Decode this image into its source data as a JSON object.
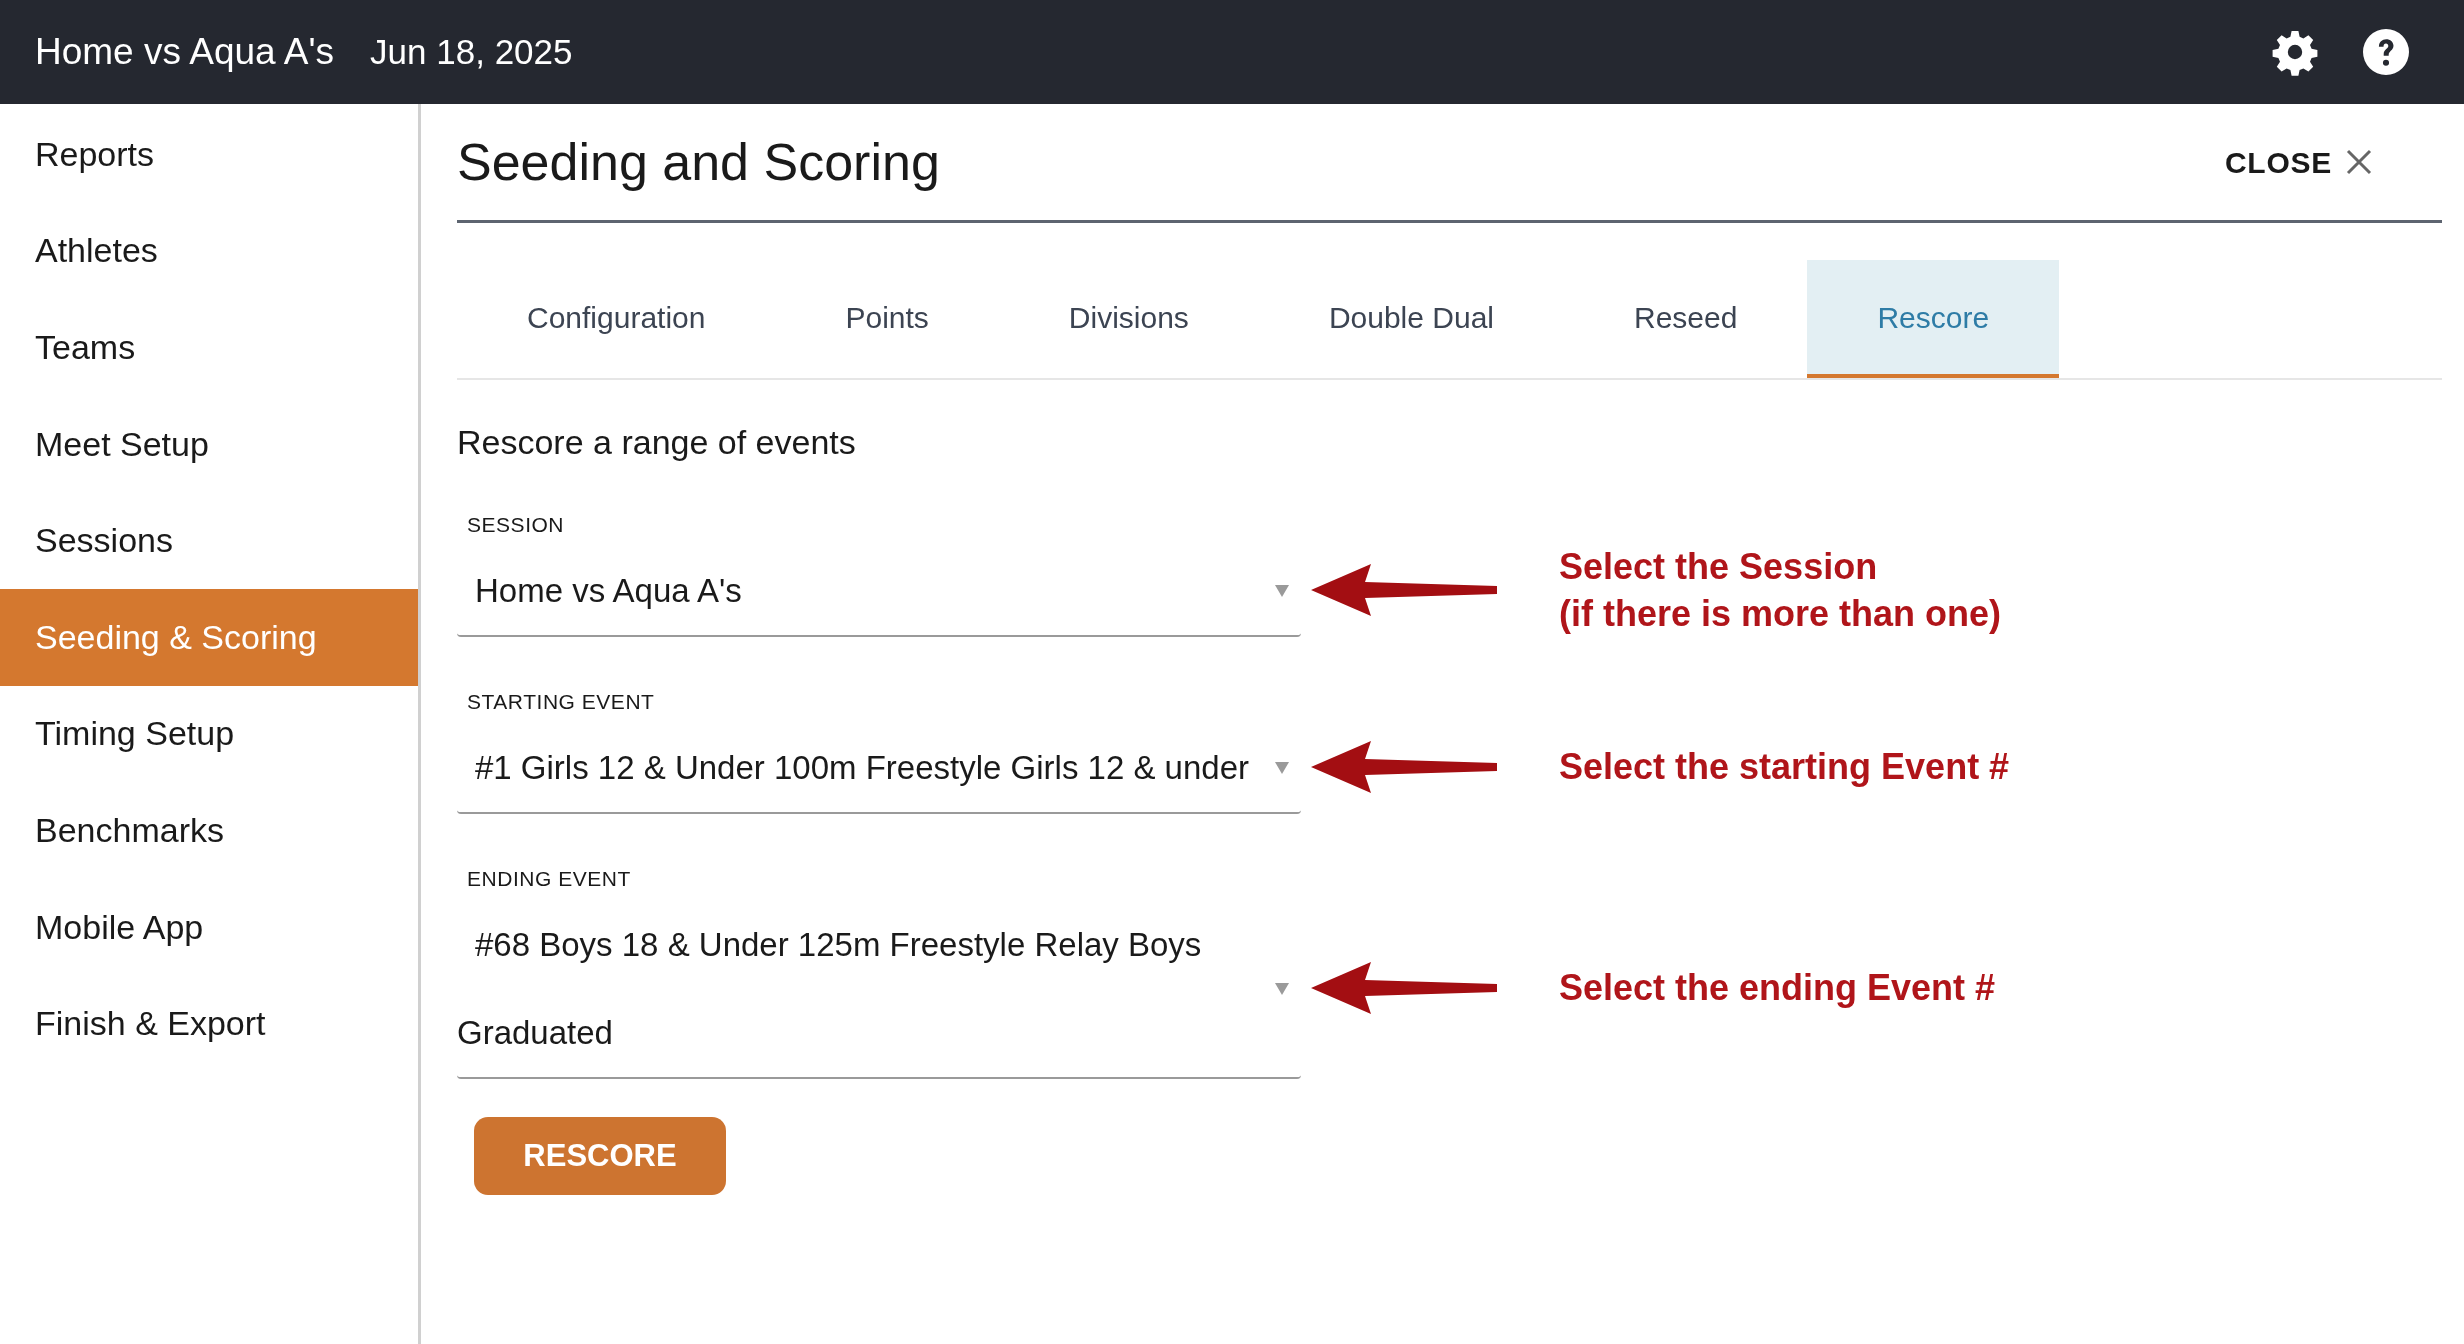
{
  "header": {
    "title": "Home vs Aqua A's",
    "date": "Jun 18, 2025"
  },
  "sidebar": {
    "items": [
      {
        "label": "Reports",
        "selected": false
      },
      {
        "label": "Athletes",
        "selected": false
      },
      {
        "label": "Teams",
        "selected": false
      },
      {
        "label": "Meet Setup",
        "selected": false
      },
      {
        "label": "Sessions",
        "selected": false
      },
      {
        "label": "Seeding & Scoring",
        "selected": true
      },
      {
        "label": "Timing Setup",
        "selected": false
      },
      {
        "label": "Benchmarks",
        "selected": false
      },
      {
        "label": "Mobile App",
        "selected": false
      },
      {
        "label": "Finish & Export",
        "selected": false
      }
    ]
  },
  "panel": {
    "title": "Seeding and Scoring",
    "close_label": "CLOSE"
  },
  "tabs": [
    {
      "label": "Configuration",
      "selected": false
    },
    {
      "label": "Points",
      "selected": false
    },
    {
      "label": "Divisions",
      "selected": false
    },
    {
      "label": "Double Dual",
      "selected": false
    },
    {
      "label": "Reseed",
      "selected": false
    },
    {
      "label": "Rescore",
      "selected": true
    }
  ],
  "section_title": "Rescore a range of events",
  "fields": [
    {
      "label": "SESSION",
      "value": "Home vs Aqua A's",
      "annotation": "Select the Session\n(if there is more than one)"
    },
    {
      "label": "STARTING EVENT",
      "value": "#1 Girls 12 & Under 100m Freestyle Girls 12 & under",
      "annotation": "Select the starting Event #"
    },
    {
      "label": "ENDING EVENT",
      "value": "#68 Boys 18 & Under 125m Freestyle Relay Boys Graduated",
      "annotation": "Select the ending Event #"
    }
  ],
  "button": "RESCORE"
}
